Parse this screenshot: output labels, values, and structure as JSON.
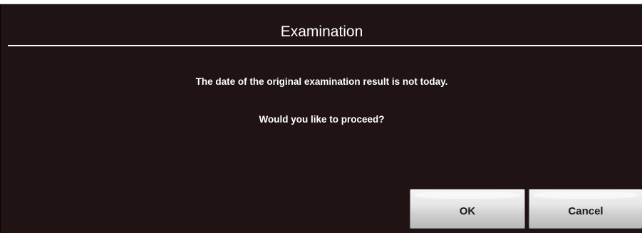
{
  "dialog": {
    "title": "Examination",
    "message_line1": "The date of the original examination result is not today.",
    "message_line2": "Would you like to proceed?"
  },
  "buttons": {
    "ok_label": "OK",
    "cancel_label": "Cancel"
  },
  "colors": {
    "background": "#1f1313",
    "text": "#ffffff",
    "button_face": "#e6e6e6"
  }
}
